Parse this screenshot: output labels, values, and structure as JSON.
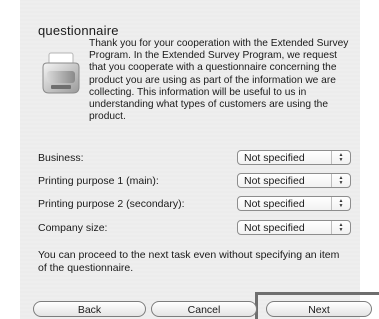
{
  "dialog": {
    "title": "questionnaire",
    "intro": "Thank you for your cooperation with the Extended Survey Program. In the Extended Survey Program, we request that you cooperate with a questionnaire concerning the product you are using as part of the information we are collecting. This information will be useful to us in understanding what types of customers are using the product."
  },
  "fields": [
    {
      "label": "Business:",
      "value": "Not specified"
    },
    {
      "label": "Printing purpose 1 (main):",
      "value": "Not specified"
    },
    {
      "label": "Printing purpose 2 (secondary):",
      "value": "Not specified"
    },
    {
      "label": "Company size:",
      "value": "Not specified"
    }
  ],
  "note": "You can proceed to the next task even without specifying an item of the questionnaire.",
  "buttons": {
    "back": "Back",
    "cancel": "Cancel",
    "next": "Next"
  }
}
